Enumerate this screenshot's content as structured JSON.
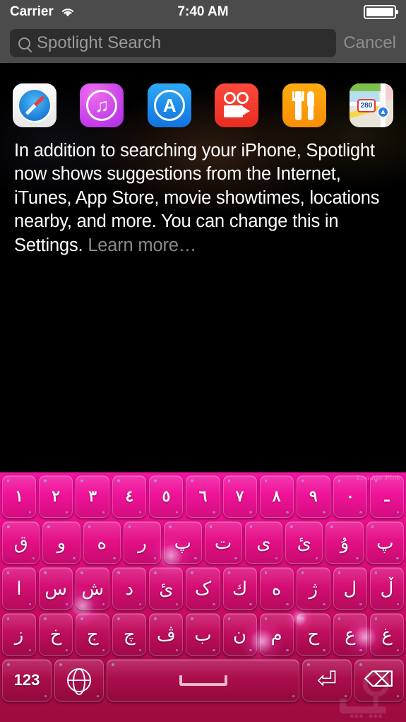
{
  "status_bar": {
    "carrier": "Carrier",
    "wifi_icon": "wifi-icon",
    "time": "7:40 AM",
    "battery_icon": "battery-full-icon"
  },
  "search": {
    "icon": "search-icon",
    "placeholder": "Spotlight Search",
    "value": "",
    "cancel_label": "Cancel"
  },
  "suggestions": {
    "icons": [
      {
        "name": "safari-icon",
        "label": "Safari"
      },
      {
        "name": "itunes-icon",
        "label": "iTunes"
      },
      {
        "name": "app-store-icon",
        "label": "App Store"
      },
      {
        "name": "movies-icon",
        "label": "Movies"
      },
      {
        "name": "restaurants-icon",
        "label": "Restaurants"
      },
      {
        "name": "maps-icon",
        "label": "Maps"
      }
    ],
    "maps_shield_label": "280",
    "description": "In addition to searching your iPhone, Spotlight now shows suggestions from the Internet, iTunes, App Store, movie showtimes, locations nearby, and more. You can change this in Settings. ",
    "learn_more_label": "Learn more…"
  },
  "keyboard": {
    "watermark_top": "London Pink",
    "rows": {
      "numbers": [
        "١",
        "٢",
        "٣",
        "٤",
        "٥",
        "٦",
        "٧",
        "٨",
        "٩",
        "٠",
        "ـ"
      ],
      "row1": [
        "ق",
        "و",
        "ه",
        "ر",
        "پ",
        "ت",
        "ى",
        "ئ",
        "ۇ",
        "پ"
      ],
      "row2": [
        "ا",
        "س",
        "ش",
        "د",
        "ئ",
        "ک",
        "ك",
        "ه",
        "ژ",
        "ل",
        "ڵ"
      ],
      "row3": [
        "ز",
        "خ",
        "ج",
        "چ",
        "ڤ",
        "ب",
        "ن",
        "م",
        "ح",
        "ع",
        "غ"
      ]
    },
    "bottom": {
      "numeric_label": "123",
      "globe_icon": "globe-icon",
      "space_label": "",
      "return_icon": "return-icon",
      "return_glyph": "⏎",
      "backspace_icon": "backspace-icon",
      "backspace_glyph": "⌫"
    },
    "colors": {
      "top": "#f112a0",
      "bottom": "#9c0b3e",
      "key_text": "#ffffff"
    }
  }
}
